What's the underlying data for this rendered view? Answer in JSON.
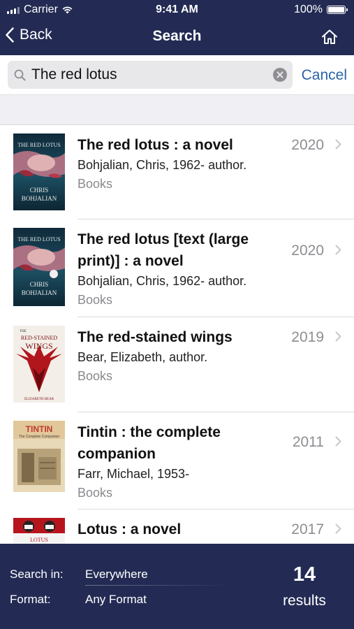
{
  "status_bar": {
    "carrier": "Carrier",
    "time": "9:41 AM",
    "battery": "100%"
  },
  "nav": {
    "back_label": "Back",
    "title": "Search",
    "home_icon": "home-icon"
  },
  "search": {
    "value": "The red lotus",
    "cancel_label": "Cancel"
  },
  "results": [
    {
      "title": "The red lotus : a novel",
      "author": "Bohjalian, Chris, 1962- author.",
      "format": "Books",
      "year": "2020",
      "cover": {
        "top_text": "THE RED LOTUS",
        "author_text": "CHRIS BOHJALIAN",
        "author_line1": "CHRIS",
        "author_line2": "BOHJALIAN"
      }
    },
    {
      "title": "The red lotus [text (large print)] : a novel",
      "author": "Bohjalian, Chris, 1962- author.",
      "format": "Books",
      "year": "2020",
      "cover": {
        "top_text": "THE RED LOTUS",
        "author_text": "CHRIS BOHJALIAN",
        "author_line1": "CHRIS",
        "author_line2": "BOHJALIAN"
      }
    },
    {
      "title": "The red-stained wings",
      "author": "Bear, Elizabeth, author.",
      "format": "Books",
      "year": "2019",
      "cover": {
        "top_text": "THE",
        "title_line1": "RED-STAINED",
        "title_line2": "WINGS",
        "author_text": "ELIZABETH BEAR"
      }
    },
    {
      "title": "Tintin : the complete companion",
      "author": "Farr, Michael, 1953-",
      "format": "Books",
      "year": "2011",
      "cover": {
        "top_text": "TINTIN",
        "sub_text": "The Complete Companion"
      }
    },
    {
      "title": "Lotus : a novel",
      "author": "",
      "format": "",
      "year": "2017",
      "cover": {
        "top_text": "LOTUS"
      }
    }
  ],
  "filters": {
    "search_in_label": "Search in:",
    "search_in_value": "Everywhere",
    "format_label": "Format:",
    "format_value": "Any Format"
  },
  "summary": {
    "count": "14",
    "label": "results"
  },
  "colors": {
    "nav_bg": "#232b54",
    "accent": "#2a64a8",
    "secondary_text": "#8e8e93"
  }
}
